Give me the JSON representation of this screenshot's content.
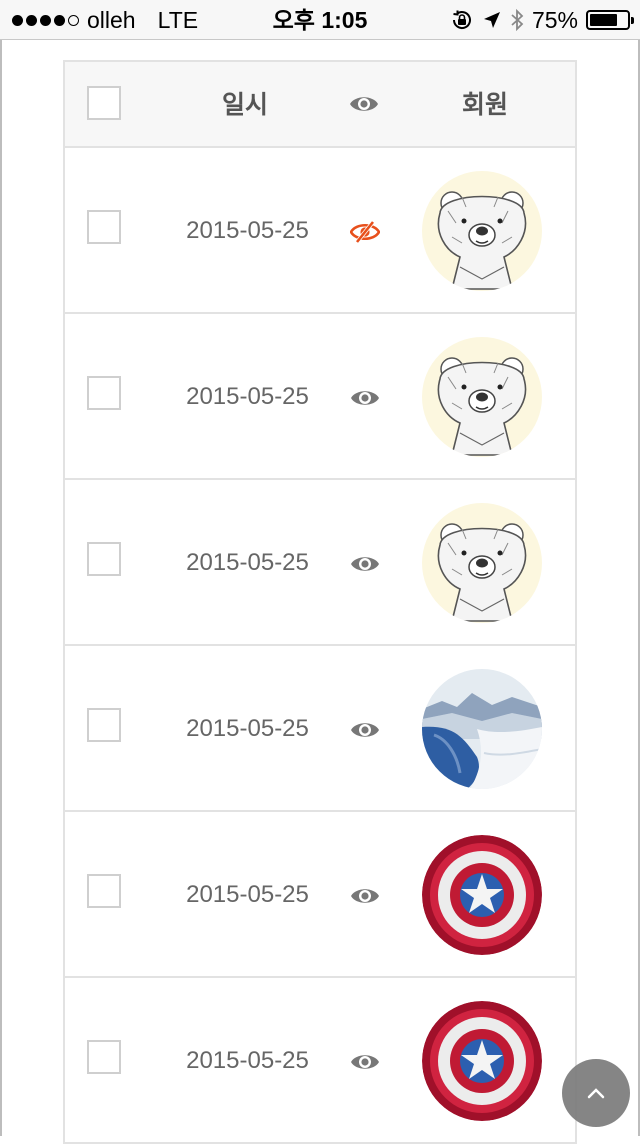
{
  "status_bar": {
    "carrier": "olleh",
    "network": "LTE",
    "time": "오후 1:05",
    "battery_text": "75%",
    "battery_level": 0.75,
    "signal_bars": 4,
    "icons": [
      "orientation-lock-icon",
      "location-arrow-icon",
      "bluetooth-icon"
    ]
  },
  "table": {
    "header": {
      "date_label": "일시",
      "visibility_icon": "eye-icon",
      "member_label": "회원"
    },
    "rows": [
      {
        "date": "2015-05-25",
        "visibility": "hidden",
        "avatar": "bear-sketch"
      },
      {
        "date": "2015-05-25",
        "visibility": "visible",
        "avatar": "bear-sketch"
      },
      {
        "date": "2015-05-25",
        "visibility": "visible",
        "avatar": "bear-sketch"
      },
      {
        "date": "2015-05-25",
        "visibility": "visible",
        "avatar": "snowy-mountain"
      },
      {
        "date": "2015-05-25",
        "visibility": "visible",
        "avatar": "captain-shield"
      },
      {
        "date": "2015-05-25",
        "visibility": "visible",
        "avatar": "captain-shield"
      }
    ]
  },
  "scroll_top_icon": "chevron-up-icon",
  "colors": {
    "accent_hidden": "#e8501c",
    "icon_gray": "#777777",
    "header_bg": "#f7f7f7",
    "border": "#e2e2e2"
  }
}
